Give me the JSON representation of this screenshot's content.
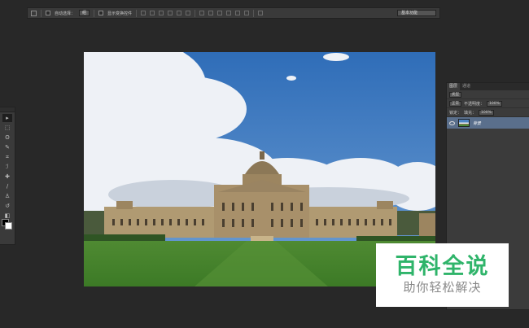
{
  "options_bar": {
    "auto_select_label": "自动选择：",
    "auto_select_value": "组",
    "show_transform_label": "显示变换控件",
    "workspace_value": "基本功能"
  },
  "tools": [
    {
      "name": "move-tool",
      "glyph": "▸",
      "active": true
    },
    {
      "name": "marquee-tool",
      "glyph": "⬚"
    },
    {
      "name": "lasso-tool",
      "glyph": "ʘ"
    },
    {
      "name": "quick-select-tool",
      "glyph": "✎"
    },
    {
      "name": "crop-tool",
      "glyph": "⌗"
    },
    {
      "name": "eyedropper-tool",
      "glyph": "ℐ"
    },
    {
      "name": "healing-tool",
      "glyph": "✚"
    },
    {
      "name": "brush-tool",
      "glyph": "∕"
    },
    {
      "name": "stamp-tool",
      "glyph": "♙"
    },
    {
      "name": "history-brush-tool",
      "glyph": "↺"
    },
    {
      "name": "eraser-tool",
      "glyph": "◧"
    },
    {
      "name": "gradient-tool",
      "glyph": "▤"
    },
    {
      "name": "blur-tool",
      "glyph": "●"
    },
    {
      "name": "dodge-tool",
      "glyph": "◐"
    },
    {
      "name": "pen-tool",
      "glyph": "✒"
    },
    {
      "name": "type-tool",
      "glyph": "T"
    },
    {
      "name": "path-select-tool",
      "glyph": "↖"
    },
    {
      "name": "shape-tool",
      "glyph": "▭"
    },
    {
      "name": "hand-tool",
      "glyph": "✋"
    },
    {
      "name": "zoom-tool",
      "glyph": "⚲"
    }
  ],
  "layers_panel": {
    "tabs": [
      "图层",
      "通道"
    ],
    "kind_filter": "类型",
    "blend_mode": "正常",
    "opacity_label": "不透明度：",
    "opacity_value": "100%",
    "lock_label": "锁定：",
    "fill_label": "填充：",
    "fill_value": "100%",
    "layer_name": "背景"
  },
  "watermark": {
    "title": "百科全说",
    "subtitle": "助你轻松解决"
  }
}
